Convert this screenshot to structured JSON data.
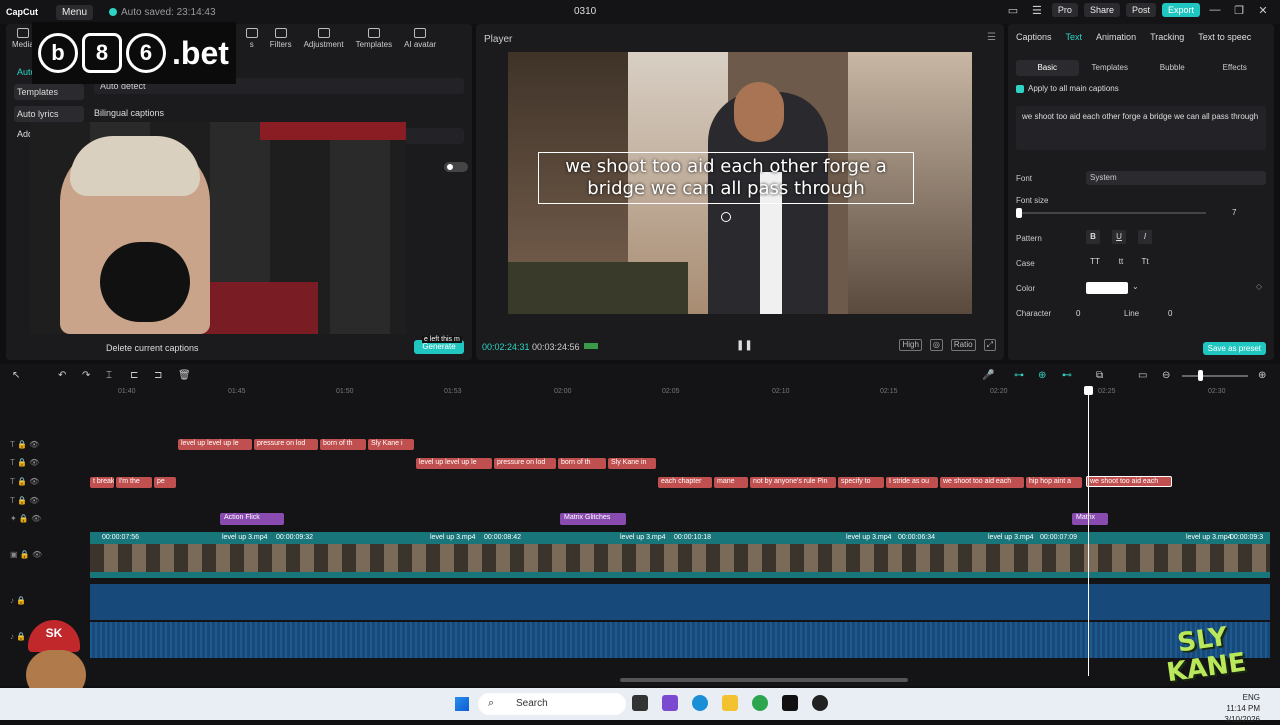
{
  "titlebar": {
    "app_logo": "CapCut",
    "menu_label": "Menu",
    "autosave": "Auto saved: 23:14:43",
    "project_name": "0310",
    "pro": "Pro",
    "share": "Share",
    "post": "Post",
    "export": "Export"
  },
  "left_panel": {
    "tools": [
      "Media",
      "s",
      "Filters",
      "Adjustment",
      "Templates",
      "AI avatar"
    ],
    "sidebar": [
      "Auto",
      "Templates",
      "Auto lyrics",
      "Add"
    ],
    "language_select": "Auto detect",
    "bilingual_label": "Bilingual captions",
    "delete_label": "Delete current captions",
    "generate_label": "Generate",
    "generate_hint": "e left this m"
  },
  "overlay_logo": {
    "coins": [
      "b",
      "8",
      "6"
    ],
    "text": ".bet"
  },
  "player": {
    "label": "Player",
    "caption": "we shoot too aid each other forge a bridge we can all pass through",
    "time_current": "00:02:24:31",
    "time_total": "00:03:24:56",
    "quality": "High",
    "ratio": "Ratio"
  },
  "right_panel": {
    "tabs": [
      "Captions",
      "Text",
      "Animation",
      "Tracking",
      "Text to speec"
    ],
    "active_tab": "Text",
    "sub_tabs": [
      "Basic",
      "Templates",
      "Bubble",
      "Effects"
    ],
    "apply_all": "Apply to all main captions",
    "text_value": "we shoot too aid each other forge a bridge we can all pass through",
    "font_label": "Font",
    "font_value": "System",
    "font_size_label": "Font size",
    "font_size_value": "7",
    "pattern_label": "Pattern",
    "pattern_buttons": [
      "B",
      "U",
      "I"
    ],
    "case_label": "Case",
    "case_buttons": [
      "TT",
      "tt",
      "Tt"
    ],
    "color_label": "Color",
    "character_label": "Character",
    "character_value": "0",
    "line_label": "Line",
    "line_value": "0",
    "save_preset": "Save as preset"
  },
  "timeline": {
    "ruler": [
      "01:40",
      "01:45",
      "01:50",
      "01:53",
      "02:00",
      "02:05",
      "02:10",
      "02:15",
      "02:20",
      "02:25",
      "02:30"
    ],
    "caption_row1": [
      "level up level up le",
      "pressure on lod",
      "born of th",
      "Sly Kane i"
    ],
    "caption_row2": [
      "level up level up le",
      "pressure on lod",
      "born of th",
      "Sly Kane in"
    ],
    "caption_row3a": [
      "t breaki",
      "I'm the",
      "pe"
    ],
    "caption_row3b": [
      "each chapter",
      "mane",
      "not by anyone's rule Pin",
      "specify to",
      "I stride as ou",
      "we shoot too aid each",
      "hip hop aint a"
    ],
    "selected_caption": "we shoot too aid each",
    "effects": [
      "Action Flick",
      "Matrix Glitches",
      "Matrix"
    ],
    "video_clips": [
      {
        "name": "",
        "dur": "00:00:07:56"
      },
      {
        "name": "level up 3.mp4",
        "dur": "00:00:09:32"
      },
      {
        "name": "level up 3.mp4",
        "dur": "00:00:08:42"
      },
      {
        "name": "level up 3.mp4",
        "dur": "00:00:10:18"
      },
      {
        "name": "level up 3.mp4",
        "dur": "00:00:06:34"
      },
      {
        "name": "level up 3.mp4",
        "dur": "00:00:07:09"
      },
      {
        "name": "level up 3.mp4",
        "dur": "00:00:09:3"
      }
    ]
  },
  "taskbar": {
    "search": "Search",
    "lang": "ENG",
    "time": "11:14 PM",
    "date": "3/10/2026"
  },
  "sk_badge": "SK",
  "sly_kane_logo": "SLY KANE",
  "colors": {
    "accent": "#20c6c0",
    "caption_clip": "#c0504f",
    "effect_clip": "#8a4bb0",
    "video_track": "#18767a",
    "audio_track": "#174a7a"
  }
}
